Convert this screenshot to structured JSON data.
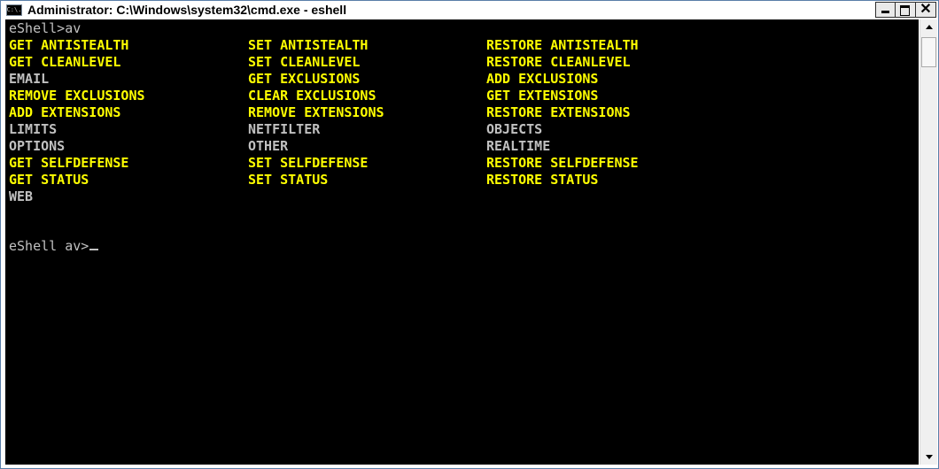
{
  "window": {
    "title": "Administrator: C:\\Windows\\system32\\cmd.exe - eshell",
    "app_icon_text": "C:\\.",
    "icons": {
      "app": "cmd-icon",
      "minimize": "minimize-icon",
      "maximize": "maximize-icon",
      "close": "close-icon"
    },
    "close_glyph": "✕"
  },
  "colors": {
    "console_bg": "#000000",
    "default_text": "#c0c0c0",
    "highlight_text": "#ffff00"
  },
  "console": {
    "command_line": "eShell>av",
    "rows": [
      {
        "cells": [
          {
            "text": "GET ANTISTEALTH",
            "color": "#ffff00"
          },
          {
            "text": "SET ANTISTEALTH",
            "color": "#ffff00"
          },
          {
            "text": "RESTORE ANTISTEALTH",
            "color": "#ffff00"
          }
        ]
      },
      {
        "cells": [
          {
            "text": "GET CLEANLEVEL",
            "color": "#ffff00"
          },
          {
            "text": "SET CLEANLEVEL",
            "color": "#ffff00"
          },
          {
            "text": "RESTORE CLEANLEVEL",
            "color": "#ffff00"
          }
        ]
      },
      {
        "cells": [
          {
            "text": "EMAIL",
            "color": "#c0c0c0"
          },
          {
            "text": "GET EXCLUSIONS",
            "color": "#ffff00"
          },
          {
            "text": "ADD EXCLUSIONS",
            "color": "#ffff00"
          }
        ]
      },
      {
        "cells": [
          {
            "text": "REMOVE EXCLUSIONS",
            "color": "#ffff00"
          },
          {
            "text": "CLEAR EXCLUSIONS",
            "color": "#ffff00"
          },
          {
            "text": "GET EXTENSIONS",
            "color": "#ffff00"
          }
        ]
      },
      {
        "cells": [
          {
            "text": "ADD EXTENSIONS",
            "color": "#ffff00"
          },
          {
            "text": "REMOVE EXTENSIONS",
            "color": "#ffff00"
          },
          {
            "text": "RESTORE EXTENSIONS",
            "color": "#ffff00"
          }
        ]
      },
      {
        "cells": [
          {
            "text": "LIMITS",
            "color": "#c0c0c0"
          },
          {
            "text": "NETFILTER",
            "color": "#c0c0c0"
          },
          {
            "text": "OBJECTS",
            "color": "#c0c0c0"
          }
        ]
      },
      {
        "cells": [
          {
            "text": "OPTIONS",
            "color": "#c0c0c0"
          },
          {
            "text": "OTHER",
            "color": "#c0c0c0"
          },
          {
            "text": "REALTIME",
            "color": "#c0c0c0"
          }
        ]
      },
      {
        "cells": [
          {
            "text": "GET SELFDEFENSE",
            "color": "#ffff00"
          },
          {
            "text": "SET SELFDEFENSE",
            "color": "#ffff00"
          },
          {
            "text": "RESTORE SELFDEFENSE",
            "color": "#ffff00"
          }
        ]
      },
      {
        "cells": [
          {
            "text": "GET STATUS",
            "color": "#ffff00"
          },
          {
            "text": "SET STATUS",
            "color": "#ffff00"
          },
          {
            "text": "RESTORE STATUS",
            "color": "#ffff00"
          }
        ]
      },
      {
        "cells": [
          {
            "text": "WEB",
            "color": "#c0c0c0"
          }
        ]
      }
    ],
    "prompt": "eShell av>"
  },
  "scrollbar": {
    "icons": {
      "up": "arrow-up-icon",
      "down": "arrow-down-icon"
    }
  }
}
